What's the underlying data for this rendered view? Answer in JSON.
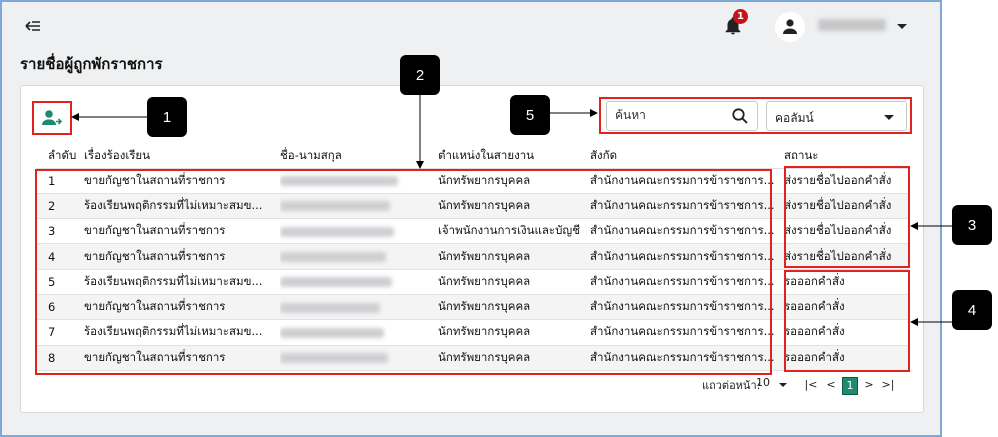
{
  "header": {
    "notification_count": "1",
    "page_title": "รายชื่อผู้ถูกพักราชการ"
  },
  "toolbar": {
    "search_placeholder": "ค้นหา",
    "column_select_label": "คอลัมน์"
  },
  "table": {
    "columns": [
      "ลำดับ",
      "เรื่องร้องเรียน",
      "ชื่อ-นามสกุล",
      "ตำแหน่งในสายงาน",
      "สังกัด",
      "สถานะ"
    ],
    "rows": [
      {
        "no": "1",
        "subject": "ขายกัญชาในสถานที่ราชการ",
        "position": "นักทรัพยากรบุคคล",
        "org": "สำนักงานคณะกรรมการข้าราชการ...",
        "status": "ส่งรายชื่อไปออกคำสั่ง"
      },
      {
        "no": "2",
        "subject": "ร้องเรียนพฤติกรรมที่ไม่เหมาะสมข...",
        "position": "นักทรัพยากรบุคคล",
        "org": "สำนักงานคณะกรรมการข้าราชการ...",
        "status": "ส่งรายชื่อไปออกคำสั่ง"
      },
      {
        "no": "3",
        "subject": "ขายกัญชาในสถานที่ราชการ",
        "position": "เจ้าพนักงานการเงินและบัญชี",
        "org": "สำนักงานคณะกรรมการข้าราชการ...",
        "status": "ส่งรายชื่อไปออกคำสั่ง"
      },
      {
        "no": "4",
        "subject": "ขายกัญชาในสถานที่ราชการ",
        "position": "นักทรัพยากรบุคคล",
        "org": "สำนักงานคณะกรรมการข้าราชการ...",
        "status": "ส่งรายชื่อไปออกคำสั่ง"
      },
      {
        "no": "5",
        "subject": "ร้องเรียนพฤติกรรมที่ไม่เหมาะสมข...",
        "position": "นักทรัพยากรบุคคล",
        "org": "สำนักงานคณะกรรมการข้าราชการ...",
        "status": "รอออกคำสั่ง"
      },
      {
        "no": "6",
        "subject": "ขายกัญชาในสถานที่ราชการ",
        "position": "นักทรัพยากรบุคคล",
        "org": "สำนักงานคณะกรรมการข้าราชการ...",
        "status": "รอออกคำสั่ง"
      },
      {
        "no": "7",
        "subject": "ร้องเรียนพฤติกรรมที่ไม่เหมาะสมข...",
        "position": "นักทรัพยากรบุคคล",
        "org": "สำนักงานคณะกรรมการข้าราชการ...",
        "status": "รอออกคำสั่ง"
      },
      {
        "no": "8",
        "subject": "ขายกัญชาในสถานที่ราชการ",
        "position": "นักทรัพยากรบุคคล",
        "org": "สำนักงานคณะกรรมการข้าราชการ...",
        "status": "รอออกคำสั่ง"
      }
    ]
  },
  "pagination": {
    "rows_per_page_label": "แถวต่อหน้า:",
    "rows_per_page_value": "10",
    "current_page": "1",
    "first_icon": "|<",
    "prev_icon": "<",
    "next_icon": ">",
    "last_icon": ">|"
  },
  "callouts": [
    "1",
    "2",
    "3",
    "4",
    "5"
  ],
  "colors": {
    "accent": "#1f8a72",
    "highlight": "#e0231c",
    "badge": "#c4141a"
  },
  "icons": [
    "back-icon",
    "bell-icon",
    "user-icon",
    "add-person-icon",
    "search-icon"
  ]
}
